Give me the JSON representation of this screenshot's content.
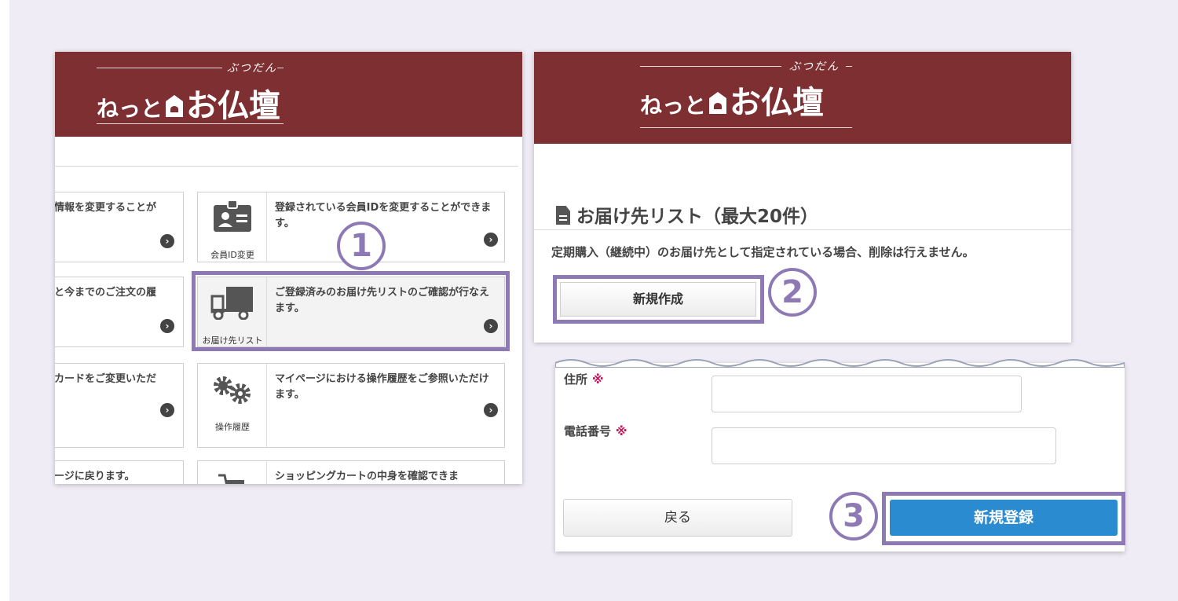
{
  "logo": {
    "kana": "ぶつだん",
    "brand_small": "ねっと",
    "brand_big": "お仏壇"
  },
  "menu": {
    "left_partial_rows": [
      "情報を変更することが",
      "と今までのご注文の履",
      "カードをご変更いただ",
      "ージに戻ります。"
    ],
    "cards": [
      {
        "icon": "id-card-icon",
        "label": "会員ID変更",
        "desc": "登録されている会員IDを変更することができます。"
      },
      {
        "icon": "truck-icon",
        "label": "お届け先リスト",
        "desc": "ご登録済みのお届け先リストのご確認が行なえます。"
      },
      {
        "icon": "gears-icon",
        "label": "操作履歴",
        "desc": "マイページにおける操作履歴をご参照いただけます。"
      },
      {
        "icon": "cart-icon",
        "label": "",
        "desc": "ショッピングカートの中身を確認できま"
      }
    ]
  },
  "steps": {
    "one": "1",
    "two": "2",
    "three": "3"
  },
  "delivery_list": {
    "title": "お届け先リスト（最大20件）",
    "notice": "定期購入（継続中）のお届け先として指定されている場合、削除は行えません。",
    "new_button": "新規作成"
  },
  "form": {
    "address_label": "住所",
    "phone_label": "電話番号",
    "required_mark": "※",
    "address_value": "",
    "phone_value": "",
    "back_button": "戻る",
    "register_button": "新規登録"
  },
  "colors": {
    "header": "#7e2f32",
    "highlight": "#8d7ab5",
    "primary_button": "#2a8bd0",
    "background": "#f0ecf6"
  }
}
